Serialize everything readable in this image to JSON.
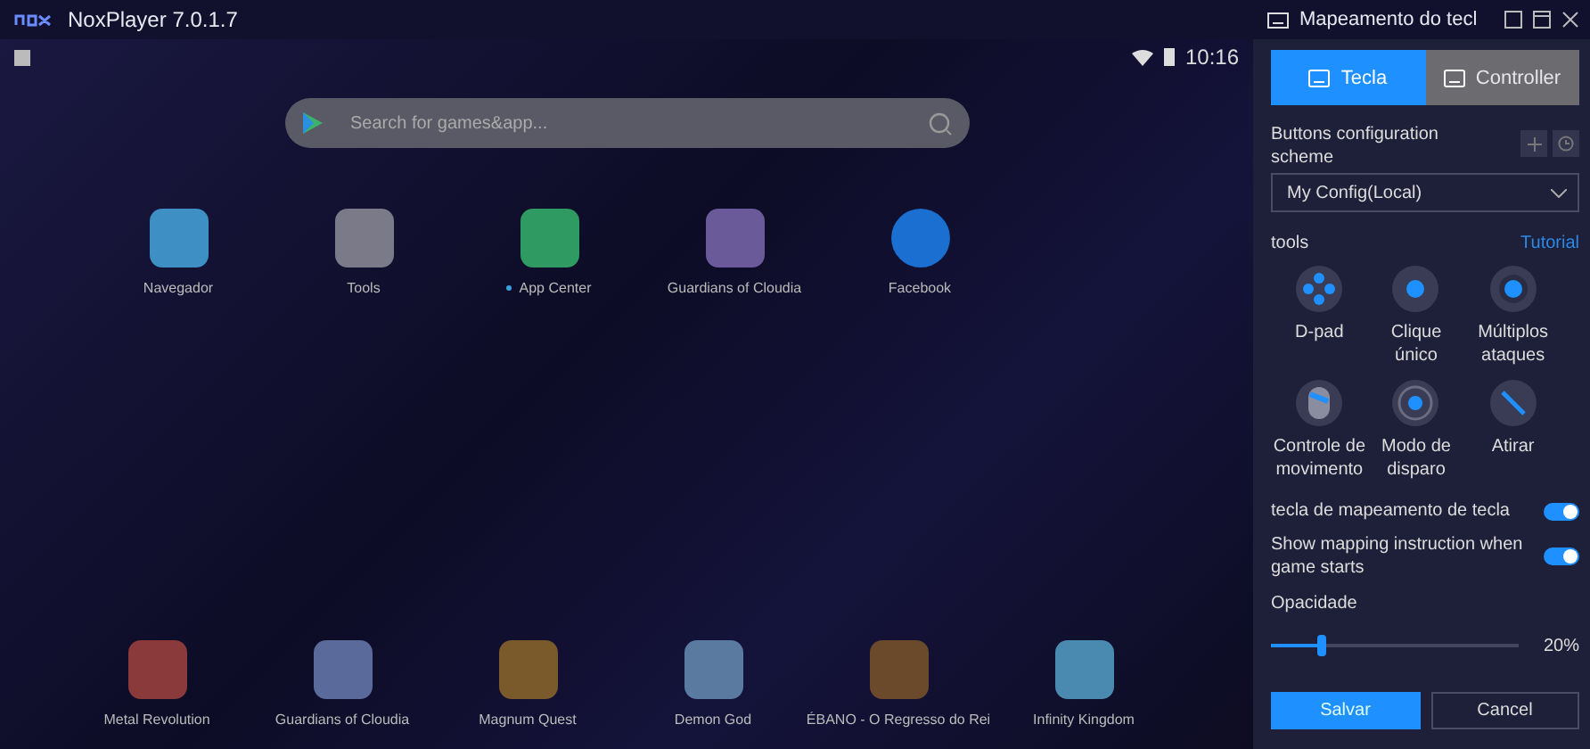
{
  "window": {
    "title": "NoxPlayer 7.0.1.7"
  },
  "android": {
    "time": "10:16",
    "search": {
      "placeholder": "Search for games&app..."
    },
    "apps": [
      {
        "label": "Navegador",
        "color": "#3d8fc4",
        "new_dot": false
      },
      {
        "label": "Tools",
        "color": "#7a7a88",
        "new_dot": false
      },
      {
        "label": "App Center",
        "color": "#2f9a62",
        "new_dot": true
      },
      {
        "label": "Guardians of Cloudia",
        "color": "#6a5a9a",
        "new_dot": false
      },
      {
        "label": "Facebook",
        "color": "#1a6fd0",
        "new_dot": false
      }
    ],
    "dock": [
      {
        "label": "Metal Revolution",
        "color": "#8a3a3a"
      },
      {
        "label": "Guardians of Cloudia",
        "color": "#5a6a9a"
      },
      {
        "label": "Magnum Quest",
        "color": "#7a5a2a"
      },
      {
        "label": "Demon God",
        "color": "#5a7aa0"
      },
      {
        "label": "ÉBANO - O Regresso do Rei",
        "color": "#6a4a2a"
      },
      {
        "label": "Infinity Kingdom",
        "color": "#4a8ab0"
      }
    ]
  },
  "panel": {
    "title": "Mapeamento do tecl",
    "tabs": [
      {
        "label": "Tecla",
        "selected": true
      },
      {
        "label": "Controller",
        "selected": false
      }
    ],
    "scheme_label": "Buttons configuration scheme",
    "scheme_value": "My Config(Local)",
    "tools_label": "tools",
    "tutorial": "Tutorial",
    "tools": [
      {
        "label": "D-pad",
        "kind": "dpad"
      },
      {
        "label": "Clique único",
        "kind": "click"
      },
      {
        "label": "Múltiplos ataques",
        "kind": "multi"
      },
      {
        "label": "Controle de movimento",
        "kind": "mouse"
      },
      {
        "label": "Modo de disparo",
        "kind": "target"
      },
      {
        "label": "Atirar",
        "kind": "shoot"
      }
    ],
    "toggles": [
      {
        "label": "tecla de mapeamento de tecla",
        "on": true
      },
      {
        "label": "Show mapping instruction when game starts",
        "on": true
      }
    ],
    "opacity": {
      "label": "Opacidade",
      "level": 0.2,
      "reading": "20%"
    },
    "buttons": {
      "save": "Salvar",
      "cancel": "Cancel"
    }
  }
}
